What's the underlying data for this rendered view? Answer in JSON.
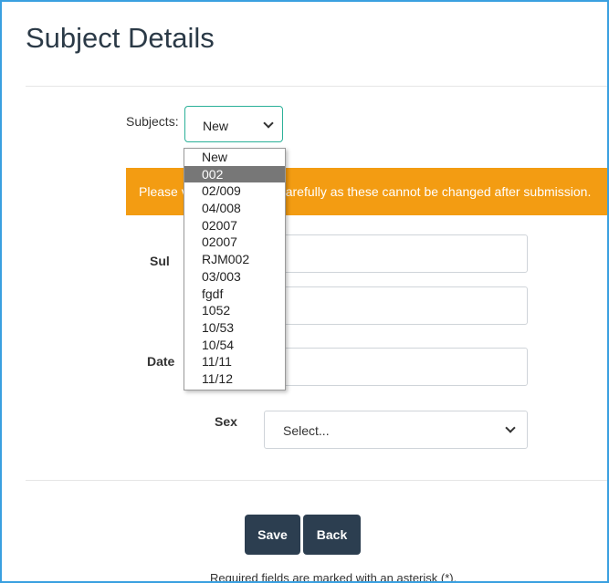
{
  "page": {
    "title": "Subject Details"
  },
  "subjects": {
    "label": "Subjects:",
    "selected": "New",
    "options": [
      "New",
      "002",
      "02/009",
      "04/008",
      "02007",
      "02007",
      "RJM002",
      "03/003",
      "fgdf",
      "1052",
      "10/53",
      "10/54",
      "11/11",
      "11/12"
    ],
    "highlighted": "002"
  },
  "warning": {
    "text_prefix": "Please v",
    "text_suffix": "carefully as these cannot be changed after submission."
  },
  "form": {
    "subject_label_partial": "Sul",
    "date_label_partial": "Date",
    "sex_label": "Sex",
    "sex_value": "Select..."
  },
  "buttons": {
    "save": "Save",
    "back": "Back"
  },
  "footnote": "Required fields are marked with an asterisk (*).",
  "colors": {
    "accent_border": "#2ab098",
    "warning": "#f39c12",
    "button": "#2c3e50",
    "frame": "#3aa0e0"
  }
}
